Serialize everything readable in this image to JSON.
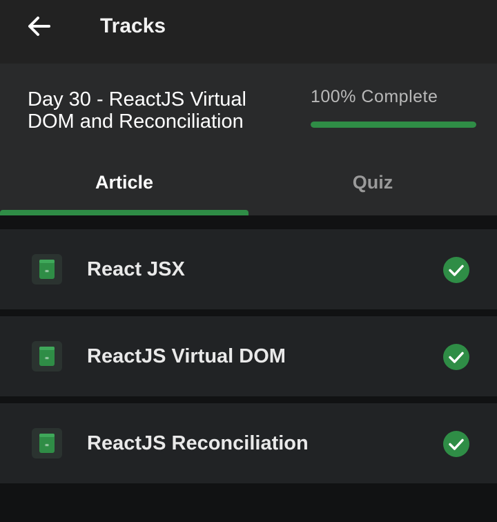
{
  "appbar": {
    "title": "Tracks",
    "back_icon": "arrow-left-icon"
  },
  "lesson": {
    "title_line1": "Day 30 - ReactJS Virtual",
    "title_line2": "DOM and Reconciliation",
    "progress_label": "100% Complete",
    "progress_fraction": 1.0
  },
  "tabs": [
    {
      "label": "Article",
      "active": true
    },
    {
      "label": "Quiz",
      "active": false
    }
  ],
  "items": [
    {
      "label": "React JSX",
      "completed": true,
      "icon": "article-icon"
    },
    {
      "label": "ReactJS Virtual DOM",
      "completed": true,
      "icon": "article-icon"
    },
    {
      "label": "ReactJS Reconciliation",
      "completed": true,
      "icon": "article-icon"
    }
  ],
  "colors": {
    "accent": "#2f8d46",
    "appbar_bg": "#222222",
    "card_bg": "#292a2b",
    "item_bg": "#212325"
  }
}
